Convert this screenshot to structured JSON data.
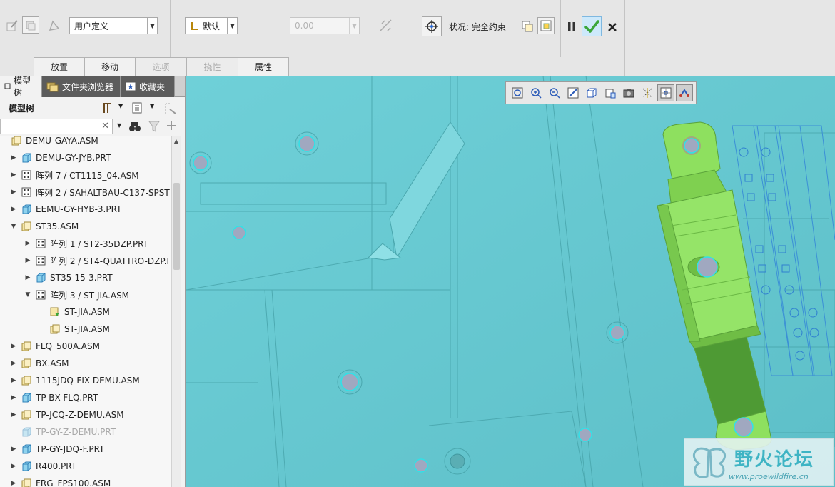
{
  "ribbon": {
    "constraint_type": "用户定义",
    "offset_option": "默认",
    "offset_value": "0.00",
    "status_label": "状况:",
    "status_value": "完全约束",
    "tabs": [
      {
        "label": "放置",
        "disabled": false
      },
      {
        "label": "移动",
        "disabled": false
      },
      {
        "label": "选项",
        "disabled": true
      },
      {
        "label": "挠性",
        "disabled": true
      },
      {
        "label": "属性",
        "disabled": false
      }
    ]
  },
  "panel": {
    "tabs": [
      "模型树",
      "文件夹浏览器",
      "收藏夹"
    ],
    "title": "模型树"
  },
  "tree": [
    {
      "label": "DEMU-GAYA.ASM",
      "icon": "asm-icon",
      "level": 0,
      "toggle": "",
      "dim": false
    },
    {
      "label": "DEMU-GY-JYB.PRT",
      "icon": "part-icon",
      "level": 1,
      "toggle": "▶",
      "dim": false
    },
    {
      "label": "阵列 7 / CT1115_04.ASM",
      "icon": "pattern-icon",
      "level": 1,
      "toggle": "▶",
      "dim": false
    },
    {
      "label": "阵列 2 / SAHALTBAU-C137-SPST",
      "icon": "pattern-icon",
      "level": 1,
      "toggle": "▶",
      "dim": false
    },
    {
      "label": "EEMU-GY-HYB-3.PRT",
      "icon": "part-icon",
      "level": 1,
      "toggle": "▶",
      "dim": false
    },
    {
      "label": "ST35.ASM",
      "icon": "asm-icon",
      "level": 1,
      "toggle": "▼",
      "dim": false
    },
    {
      "label": "阵列 1 / ST2-35DZP.PRT",
      "icon": "pattern-icon",
      "level": 2,
      "toggle": "▶",
      "dim": false
    },
    {
      "label": "阵列 2 / ST4-QUATTRO-DZP.I",
      "icon": "pattern-icon",
      "level": 2,
      "toggle": "▶",
      "dim": false
    },
    {
      "label": "ST35-15-3.PRT",
      "icon": "part-icon",
      "level": 2,
      "toggle": "▶",
      "dim": false
    },
    {
      "label": "阵列 3 / ST-JIA.ASM",
      "icon": "pattern-icon",
      "level": 2,
      "toggle": "▼",
      "dim": false
    },
    {
      "label": "ST-JIA.ASM",
      "icon": "asm-green-icon",
      "level": 3,
      "toggle": "",
      "dim": false
    },
    {
      "label": "ST-JIA.ASM",
      "icon": "asm-icon",
      "level": 3,
      "toggle": "",
      "dim": false
    },
    {
      "label": "FLQ_500A.ASM",
      "icon": "asm-icon",
      "level": 1,
      "toggle": "▶",
      "dim": false
    },
    {
      "label": "BX.ASM",
      "icon": "asm-icon",
      "level": 1,
      "toggle": "▶",
      "dim": false
    },
    {
      "label": "1115JDQ-FIX-DEMU.ASM",
      "icon": "asm-icon",
      "level": 1,
      "toggle": "▶",
      "dim": false
    },
    {
      "label": "TP-BX-FLQ.PRT",
      "icon": "part-icon",
      "level": 1,
      "toggle": "▶",
      "dim": false
    },
    {
      "label": "TP-JCQ-Z-DEMU.ASM",
      "icon": "asm-icon",
      "level": 1,
      "toggle": "▶",
      "dim": false
    },
    {
      "label": "TP-GY-Z-DEMU.PRT",
      "icon": "part-icon",
      "level": 1,
      "toggle": "",
      "dim": true
    },
    {
      "label": "TP-GY-JDQ-F.PRT",
      "icon": "part-icon",
      "level": 1,
      "toggle": "▶",
      "dim": false
    },
    {
      "label": "R400.PRT",
      "icon": "part-icon",
      "level": 1,
      "toggle": "▶",
      "dim": false
    },
    {
      "label": "FRG_FPS100.ASM",
      "icon": "asm-icon",
      "level": 1,
      "toggle": "▶",
      "dim": false
    }
  ],
  "watermark": {
    "title": "野火论坛",
    "url": "www.proewildfire.cn"
  },
  "colors": {
    "viewport_bg": "#67c9d1",
    "part_green": "#8ee05f",
    "confirm_green": "#3aa63a"
  }
}
